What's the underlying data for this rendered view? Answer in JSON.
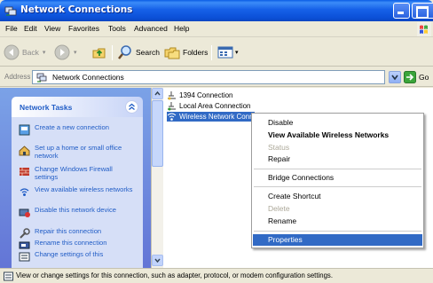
{
  "window": {
    "title": "Network Connections"
  },
  "menubar": {
    "items": [
      "File",
      "Edit",
      "View",
      "Favorites",
      "Tools",
      "Advanced",
      "Help"
    ]
  },
  "toolbar": {
    "back_label": "Back",
    "search_label": "Search",
    "folders_label": "Folders"
  },
  "address": {
    "label": "Address",
    "value": "Network Connections",
    "go_label": "Go"
  },
  "taskpane": {
    "title": "Network Tasks",
    "tasks": [
      "Create a new connection",
      "Set up a home or small office network",
      "Change Windows Firewall settings",
      "View available wireless networks",
      "Disable this network device",
      "Repair this connection",
      "Rename this connection",
      "Change settings of this"
    ]
  },
  "connections": [
    "1394 Connection",
    "Local Area Connection",
    "Wireless Network Conr"
  ],
  "context_menu": {
    "items": [
      "Disable",
      "View Available Wireless Networks",
      "Status",
      "Repair",
      "Bridge Connections",
      "Create Shortcut",
      "Delete",
      "Rename",
      "Properties"
    ]
  },
  "statusbar": {
    "text": "View or change settings for this connection, such as adapter, protocol, or modem configuration settings."
  },
  "colors": {
    "titlebar": "#0b4fd6",
    "selection": "#316ac5",
    "task_link": "#215dc6",
    "task_pane": "#6375d6"
  }
}
